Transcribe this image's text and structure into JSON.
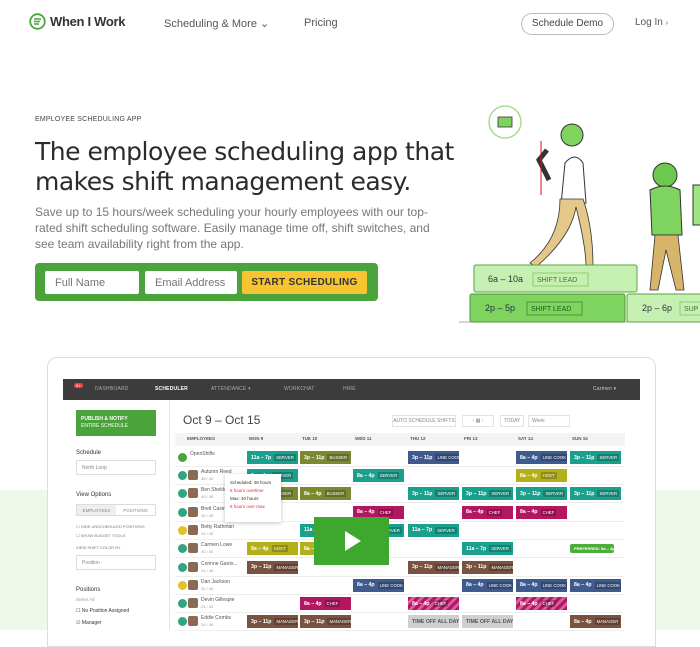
{
  "header": {
    "logo": "When I Work",
    "nav": [
      "Scheduling & More",
      "Pricing"
    ],
    "demo": "Schedule Demo",
    "login": "Log In"
  },
  "hero": {
    "eyebrow": "EMPLOYEE SCHEDULING APP",
    "title_1": "The employee scheduling app that",
    "title_2": "makes shift management easy.",
    "subtitle": "Save up to 15 hours/week scheduling your hourly employees with our top-rated shift scheduling software. Easily manage time off, shift switches, and see team availability right from the app.",
    "name_placeholder": "Full Name",
    "email_placeholder": "Email Address",
    "cta": "START SCHEDULING"
  },
  "illustration": {
    "blocks": [
      {
        "time": "6a – 10a",
        "role": "SHIFT LEAD"
      },
      {
        "time": "2p – 5p",
        "role": "SHIFT LEAD"
      },
      {
        "time": "2p – 6p",
        "role": "SUP"
      }
    ]
  },
  "app": {
    "topbar": {
      "badge": "9+",
      "items": [
        "DASHBOARD",
        "SCHEDULER",
        "ATTENDANCE ▾",
        "WORKCHAT",
        "HIRE"
      ],
      "user": "Carmen ▾"
    },
    "sidebar": {
      "publish": "PUBLISH & NOTIFY",
      "publish_sub": "ENTIRE SCHEDULE",
      "schedule_label": "Schedule",
      "schedule_value": "North Loop",
      "view_options": "View Options",
      "tab_employees": "EMPLOYEES",
      "tab_positions": "POSITIONS",
      "hide_unscheduled": "HIDE UNSCHEDULED POSITIONS",
      "show_budget": "SHOW BUDGET TOOLS",
      "color_by": "VIEW SHIFT COLOR BY",
      "color_value": "Position",
      "positions": "Positions",
      "select_all": "Select All",
      "no_position": "No Position Assigned",
      "manager": "Manager"
    },
    "date_range": "Oct 9 – Oct 15",
    "tools": {
      "auto": "AUTO SCHEDULE SHIFTS",
      "today": "TODAY",
      "view": "Week"
    },
    "days": [
      "MON 9",
      "TUE 10",
      "WED 11",
      "THU 12",
      "FRI 13",
      "SAT 14",
      "SUN 15"
    ],
    "employees_header": "EMPLOYEES",
    "colors": {
      "SERVER": "#1aa08c",
      "BUSSER": "#7b8a30",
      "LINE COOK": "#3e5a8e",
      "HOST": "#b4b01c",
      "CHEF": "#b3175f",
      "MANAGER": "#7a5240",
      "TIMEOFF": "#cfcfcf",
      "PREF": "#4cae3a"
    },
    "rows": [
      {
        "name": "OpenShifts",
        "hours": "",
        "status": "open",
        "shifts": [
          [
            0,
            "11a – 7p",
            "SERVER"
          ],
          [
            1,
            "3p – 11p",
            "BUSSER"
          ],
          [
            3,
            "3p – 11p",
            "LINE COOK"
          ],
          [
            5,
            "8a – 4p",
            "LINE COOK"
          ],
          [
            6,
            "3p – 11p",
            "SERVER"
          ]
        ]
      },
      {
        "name": "Autumn Reed",
        "hours": "48 / 40",
        "status": "ok",
        "shifts": [
          [
            0,
            "8a – 4p",
            "SERVER"
          ],
          [
            2,
            "8a – 4p",
            "SERVER"
          ],
          [
            5,
            "8a – 4p",
            "HOST"
          ]
        ]
      },
      {
        "name": "Ben Sheldon",
        "hours": "40 / 40",
        "status": "ok",
        "shifts": [
          [
            0,
            "8a – 4p",
            "BUSSER"
          ],
          [
            1,
            "8a – 4p",
            "BUSSER"
          ],
          [
            3,
            "3p – 11p",
            "SERVER"
          ],
          [
            4,
            "3p – 11p",
            "SERVER"
          ],
          [
            5,
            "3p – 11p",
            "SERVER"
          ],
          [
            6,
            "3p – 11p",
            "SERVER"
          ]
        ]
      },
      {
        "name": "Brett Casino",
        "hours": "40 / 40",
        "status": "ok",
        "shifts": [
          [
            2,
            "8a – 4p",
            "CHEF"
          ],
          [
            4,
            "8a – 4p",
            "CHEF"
          ],
          [
            5,
            "8a – 4p",
            "CHEF"
          ]
        ]
      },
      {
        "name": "Betty Rathman",
        "hours": "24 / 40",
        "status": "warn",
        "shifts": [
          [
            1,
            "11a – 7p",
            "SERVER"
          ],
          [
            2,
            "11a – 7p",
            "SERVER"
          ],
          [
            3,
            "11a – 7p",
            "SERVER"
          ]
        ]
      },
      {
        "name": "Carmen Lowe",
        "hours": "40 / 40",
        "status": "ok",
        "shifts": [
          [
            0,
            "8a – 4p",
            "HOST"
          ],
          [
            1,
            "8a – 4p",
            "HOST"
          ],
          [
            4,
            "11a – 7p",
            "SERVER"
          ],
          [
            6,
            "PREFERRED: 8a – 4p",
            "PREF"
          ]
        ]
      },
      {
        "name": "Corinne Garris...",
        "hours": "24 / 40",
        "status": "ok",
        "shifts": [
          [
            0,
            "3p – 11p",
            "MANAGER"
          ],
          [
            3,
            "3p – 11p",
            "MANAGER"
          ],
          [
            4,
            "3p – 11p",
            "MANAGER"
          ]
        ]
      },
      {
        "name": "Dan Jackson",
        "hours": "32 / 40",
        "status": "warn",
        "shifts": [
          [
            2,
            "8a – 4p",
            "LINE COOK"
          ],
          [
            4,
            "8a – 4p",
            "LINE COOK"
          ],
          [
            5,
            "8a – 4p",
            "LINE COOK"
          ],
          [
            6,
            "8a – 4p",
            "LINE COOK"
          ]
        ]
      },
      {
        "name": "Devin Gillespie",
        "hours": "24 / 40",
        "status": "ok",
        "shifts": [
          [
            1,
            "8a – 4p",
            "CHEF"
          ],
          [
            3,
            "8a – 4p",
            "CHEF*"
          ],
          [
            5,
            "8a – 4p",
            "CHEF*"
          ]
        ]
      },
      {
        "name": "Eddie Combs",
        "hours": "24 / 40",
        "status": "ok",
        "shifts": [
          [
            0,
            "3p – 11p",
            "MANAGER"
          ],
          [
            1,
            "3p – 11p",
            "MANAGER"
          ],
          [
            3,
            "TIME OFF ALL DAY",
            "TIMEOFF"
          ],
          [
            4,
            "TIME OFF ALL DAY",
            "TIMEOFF"
          ],
          [
            6,
            "8a – 4p",
            "MANAGER"
          ]
        ]
      }
    ],
    "tooltip": {
      "scheduled": "Scheduled: 48 hours",
      "overtime": "8 hours overtime",
      "max": "Max: 40 hours",
      "over_max": "8 hours over max"
    }
  }
}
